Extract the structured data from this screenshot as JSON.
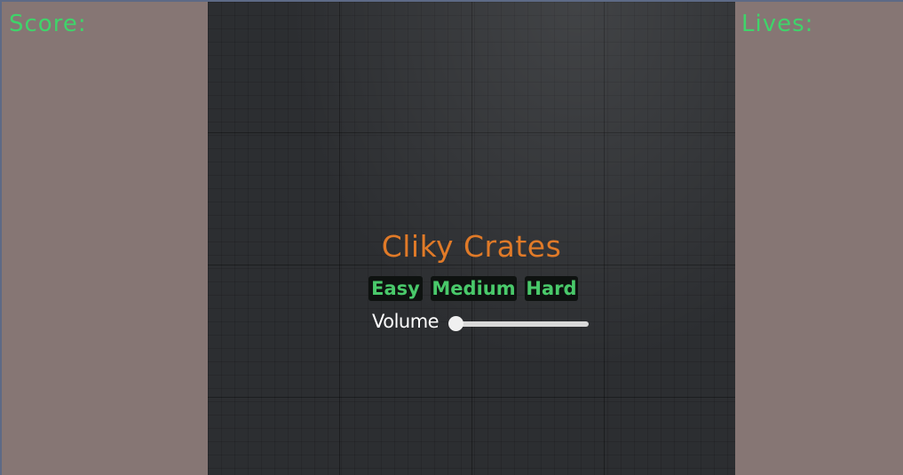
{
  "hud": {
    "score_label": "Score:",
    "lives_label": "Lives:"
  },
  "menu": {
    "title": "Cliky Crates",
    "difficulty_buttons": [
      {
        "label": "Easy"
      },
      {
        "label": "Medium"
      },
      {
        "label": "Hard"
      }
    ],
    "volume": {
      "label": "Volume",
      "value": 0
    }
  },
  "colors": {
    "hud_text": "#3fd46a",
    "title": "#e07a28",
    "button_text": "#49c96a",
    "button_bg": "#0e1210",
    "side_panel": "#867674",
    "play_area": "#2c2e31"
  }
}
